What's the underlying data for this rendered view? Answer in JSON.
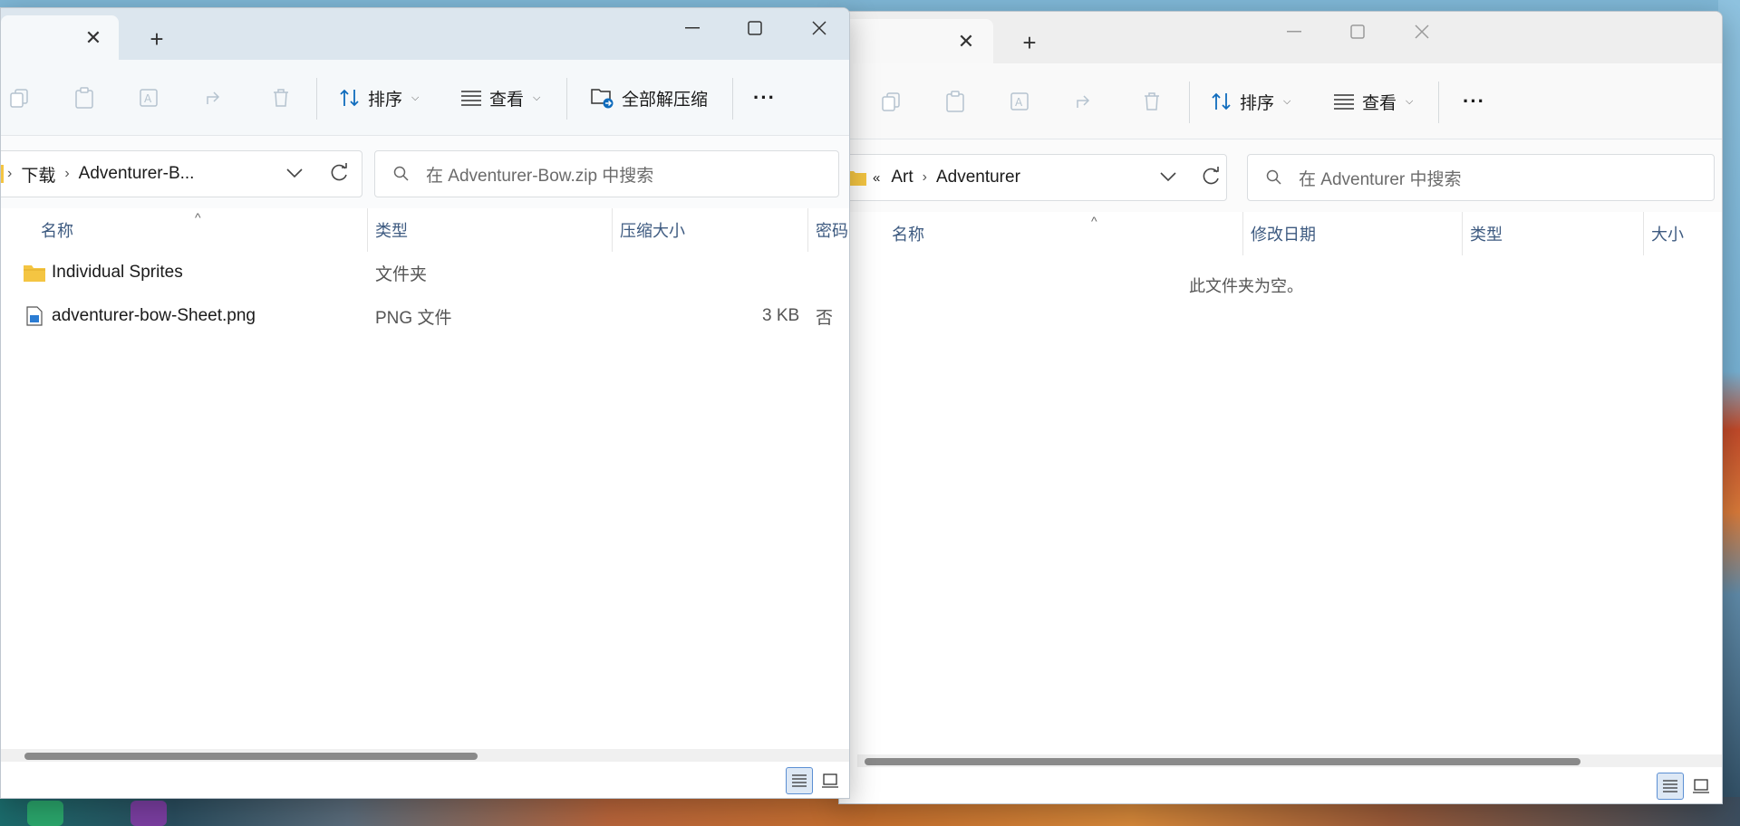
{
  "colors": {
    "accent": "#0f6cbd",
    "folder": "#f4c542",
    "link": "#3d5a80"
  },
  "left": {
    "tab_close": "✕",
    "new_tab": "+",
    "toolbar": {
      "sort_label": "排序",
      "view_label": "查看",
      "extract_label": "全部解压缩",
      "more": "···"
    },
    "breadcrumb": [
      "下载",
      "Adventurer-B..."
    ],
    "search_placeholder": "在 Adventurer-Bow.zip 中搜索",
    "columns": [
      "名称",
      "类型",
      "压缩大小",
      "密码"
    ],
    "rows": [
      {
        "name": "Individual Sprites",
        "type": "文件夹",
        "size": "",
        "password": "",
        "icon": "folder-icon"
      },
      {
        "name": "adventurer-bow-Sheet.png",
        "type": "PNG 文件",
        "size": "3 KB",
        "password": "否",
        "icon": "image-file-icon"
      }
    ]
  },
  "right": {
    "tab_close": "✕",
    "new_tab": "+",
    "toolbar": {
      "sort_label": "排序",
      "view_label": "查看",
      "more": "···"
    },
    "breadcrumb_prefix": "«",
    "breadcrumb": [
      "Art",
      "Adventurer"
    ],
    "search_placeholder": "在 Adventurer 中搜索",
    "columns": [
      "名称",
      "修改日期",
      "类型",
      "大小"
    ],
    "empty_message": "此文件夹为空。"
  }
}
